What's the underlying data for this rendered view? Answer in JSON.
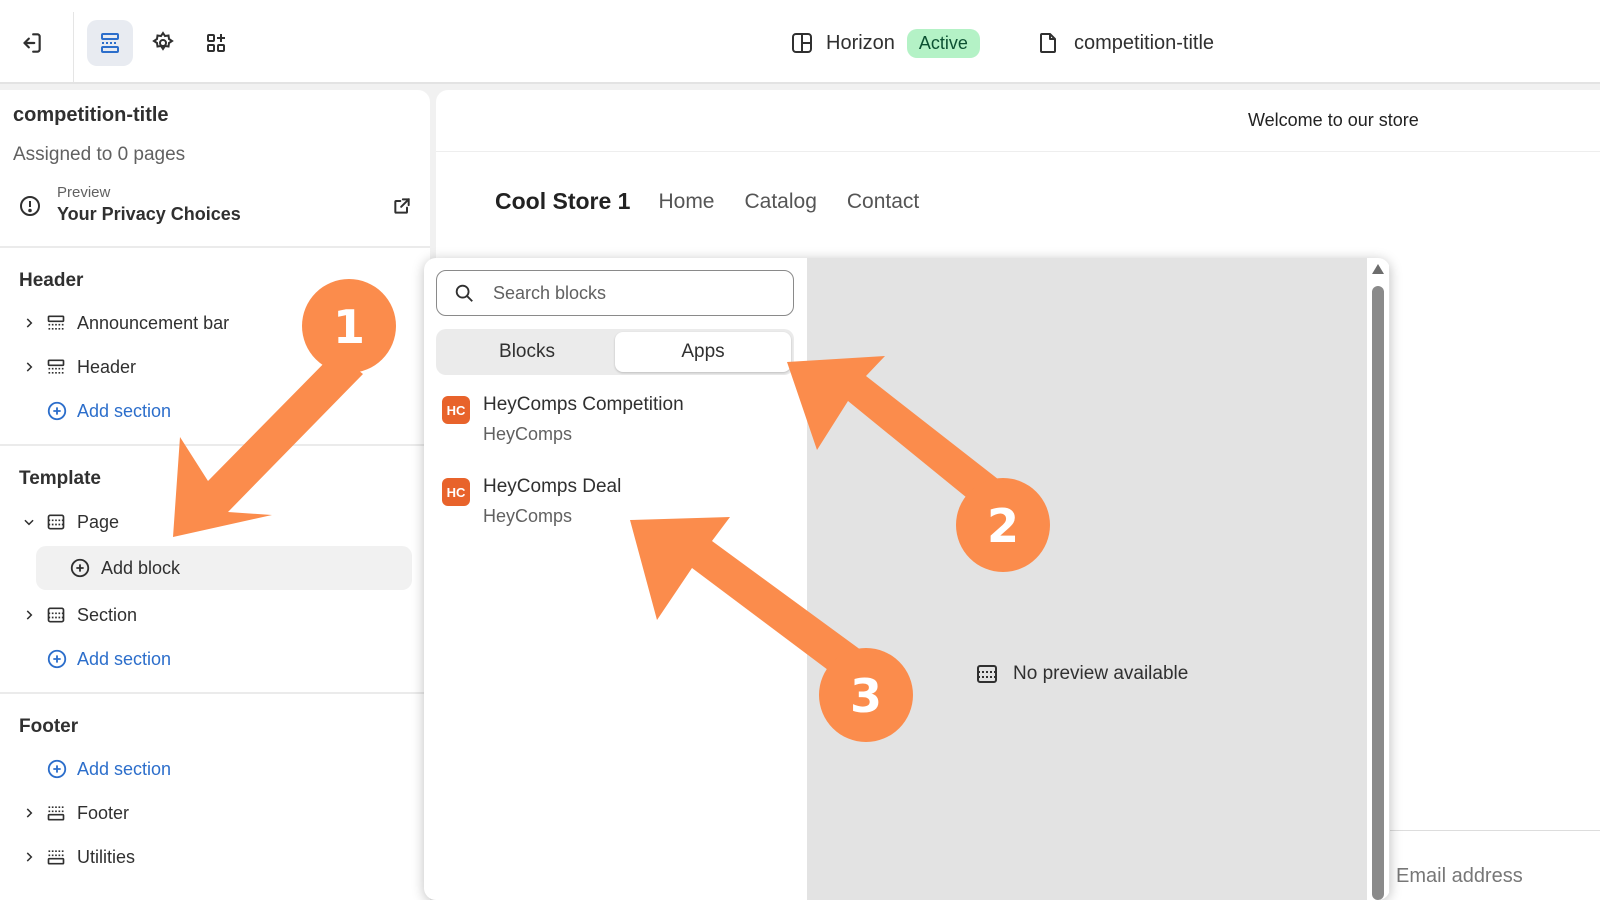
{
  "topbar": {
    "theme_name": "Horizon",
    "theme_status": "Active",
    "template_name": "competition-title"
  },
  "sidebar": {
    "title": "competition-title",
    "subtitle": "Assigned to 0 pages",
    "preview_label": "Preview",
    "preview_value": "Your Privacy Choices",
    "groups": {
      "header": {
        "title": "Header",
        "items": [
          "Announcement bar",
          "Header"
        ],
        "add_label": "Add section"
      },
      "template": {
        "title": "Template",
        "page_label": "Page",
        "add_block_label": "Add block",
        "section_label": "Section",
        "add_label": "Add section"
      },
      "footer": {
        "title": "Footer",
        "add_label": "Add section",
        "items": [
          "Footer",
          "Utilities"
        ]
      }
    }
  },
  "canvas": {
    "announcement": "Welcome to our store",
    "store_name": "Cool Store 1",
    "nav": [
      "Home",
      "Catalog",
      "Contact"
    ],
    "email_placeholder": "Email address"
  },
  "picker": {
    "search_placeholder": "Search blocks",
    "tabs": [
      {
        "label": "Blocks",
        "selected": false
      },
      {
        "label": "Apps",
        "selected": true
      }
    ],
    "apps": [
      {
        "logo": "HC",
        "name": "HeyComps Competition",
        "vendor": "HeyComps"
      },
      {
        "logo": "HC",
        "name": "HeyComps Deal",
        "vendor": "HeyComps"
      }
    ],
    "no_preview": "No preview available"
  },
  "annotations": {
    "color": "#fb8c4c",
    "markers": [
      "1",
      "2",
      "3"
    ]
  }
}
